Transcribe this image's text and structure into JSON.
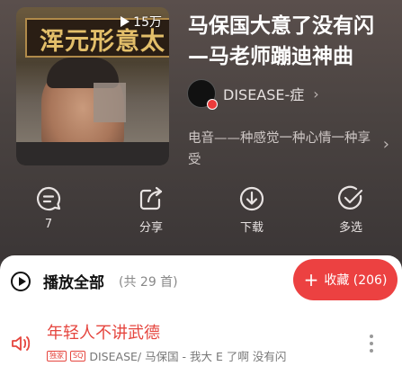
{
  "playlist": {
    "cover": {
      "play_count": "15万",
      "banner_text": "浑元形意太"
    },
    "title": "马保国大意了没有闪—马老师蹦迪神曲",
    "creator": {
      "name": "DISEASE-症"
    },
    "description": "电音——种感觉一种心情一种享受"
  },
  "actions": [
    {
      "id": "comment",
      "label": "7",
      "icon": "comment-icon"
    },
    {
      "id": "share",
      "label": "分享",
      "icon": "share-icon"
    },
    {
      "id": "download",
      "label": "下载",
      "icon": "download-icon"
    },
    {
      "id": "multiselect",
      "label": "多选",
      "icon": "check-circle-icon"
    }
  ],
  "list_header": {
    "play_all": "播放全部",
    "count": "(共 29 首)",
    "collect": "收藏 (206)"
  },
  "song": {
    "title": "年轻人不讲武德",
    "tag_exclusive": "独家",
    "tag_sq": "SQ",
    "meta": "DISEASE/ 马保国 - 我大 E 了啊 没有闪"
  },
  "colors": {
    "accent": "#ec4141",
    "playing": "#e5453e"
  }
}
